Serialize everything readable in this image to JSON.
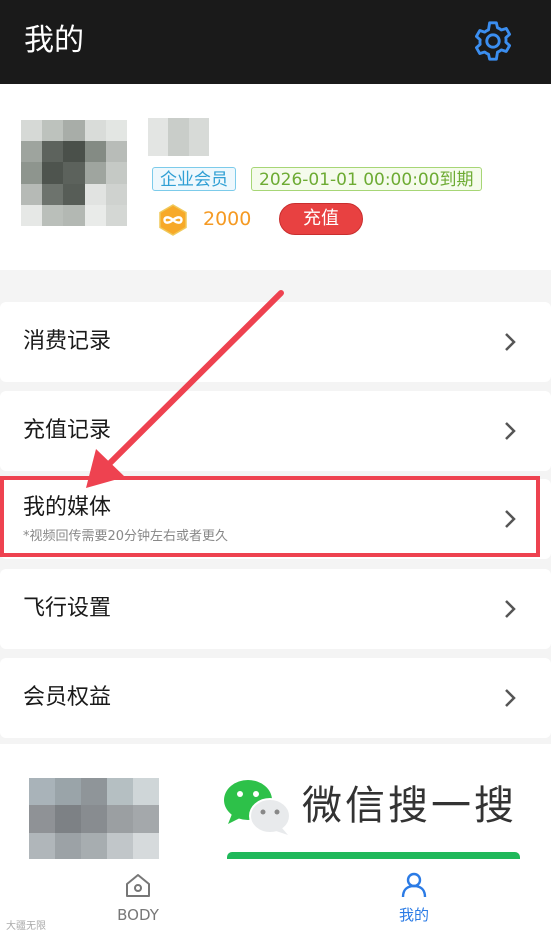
{
  "header": {
    "title": "我的",
    "settings_icon": "gear-icon"
  },
  "profile": {
    "member_badge": "企业会员",
    "expiry_badge": "2026-01-01 00:00:00到期",
    "coins": "2000",
    "recharge_label": "充值"
  },
  "menu": [
    {
      "label": "消费记录"
    },
    {
      "label": "充值记录"
    },
    {
      "label": "我的媒体",
      "note": "*视频回传需要20分钟左右或者更久"
    },
    {
      "label": "飞行设置"
    },
    {
      "label": "会员权益"
    }
  ],
  "banner": {
    "text": "微信搜一搜"
  },
  "tabbar": {
    "tabs": [
      {
        "label": "BODY"
      },
      {
        "label": "我的"
      }
    ]
  },
  "watermark": "大疆无限",
  "colors": {
    "accent": "#2b7be5",
    "recharge": "#e84141",
    "highlight": "#ee4250"
  }
}
